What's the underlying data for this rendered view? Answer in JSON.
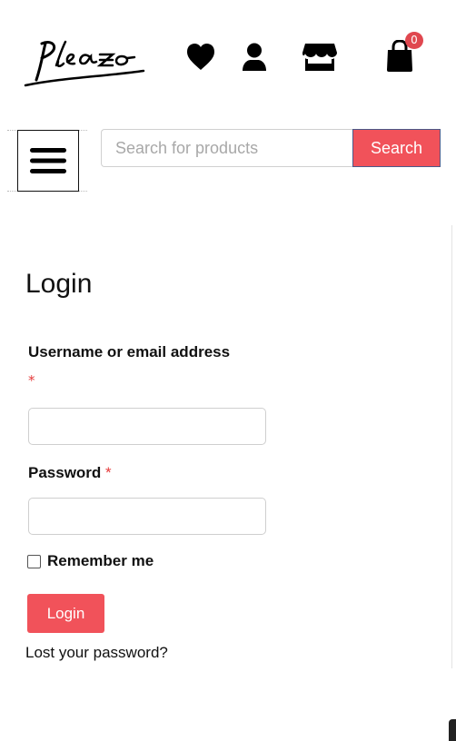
{
  "header": {
    "logo_text": "Pleazo",
    "cart_count": "0",
    "icons": [
      "heart-icon",
      "user-icon",
      "store-icon",
      "shopping-bag-icon",
      "hamburger-menu-icon"
    ]
  },
  "search": {
    "placeholder": "Search for products",
    "value": "",
    "button_label": "Search"
  },
  "login": {
    "title": "Login",
    "username_label": "Username or email address",
    "username_required": "*",
    "username_value": "",
    "password_label": "Password",
    "password_required": "*",
    "password_value": "",
    "remember_label": "Remember me",
    "remember_checked": false,
    "submit_label": "Login",
    "lost_password": "Lost your password?"
  },
  "colors": {
    "accent": "#f1525a",
    "badge": "#e0474f",
    "required": "#e53b3b",
    "text": "#111111"
  }
}
